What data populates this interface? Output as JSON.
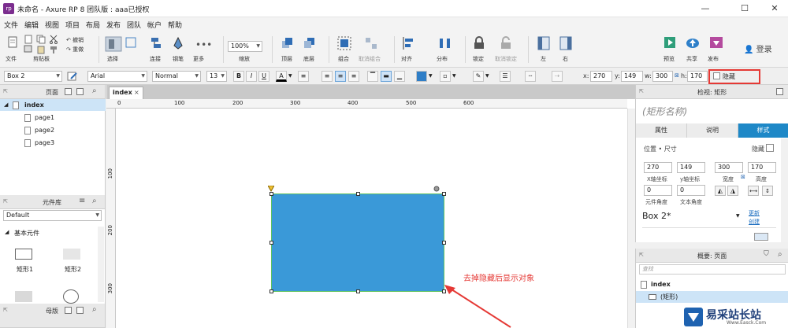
{
  "window": {
    "title": "未命名 - Axure RP 8 团队版 : aaa已授权",
    "app_icon": "rp",
    "controls": {
      "minimize": "—",
      "maximize": "☐",
      "close": "✕"
    }
  },
  "menu": [
    "文件",
    "编辑",
    "视图",
    "项目",
    "布局",
    "发布",
    "团队",
    "帐户",
    "帮助"
  ],
  "toolbar": {
    "file": "文件",
    "clipboard": "剪贴板",
    "undo": "撤销",
    "redo": "重做",
    "select": "选择",
    "connect": "连接",
    "pen": "钢笔",
    "more": "更多",
    "zoom_value": "100%",
    "zoom_label": "缩放",
    "top": "顶层",
    "bottom": "底层",
    "group": "组合",
    "ungroup": "取消组合",
    "align": "对齐",
    "distribute": "分布",
    "lock": "锁定",
    "unlock": "取消锁定",
    "left": "左",
    "right": "右",
    "preview": "预览",
    "share": "共享",
    "publish": "发布",
    "login": "登录"
  },
  "formatbar": {
    "shape_name": "Box 2",
    "font": "Arial",
    "style": "Normal",
    "size": "13",
    "bold": "B",
    "italic": "I",
    "underline": "U",
    "text_color": "A",
    "x_label": "x:",
    "x": "270",
    "y_label": "y:",
    "y": "149",
    "w_label": "w:",
    "w": "300",
    "h_label": "h:",
    "h": "170",
    "hide_label": "隐藏"
  },
  "pages_panel": {
    "title": "页面",
    "items": [
      "index",
      "page1",
      "page2",
      "page3"
    ]
  },
  "widgets_panel": {
    "title": "元件库",
    "library": "Default",
    "category": "基本元件",
    "items": [
      "矩形1",
      "矩形2"
    ]
  },
  "masters_panel": {
    "title": "母版"
  },
  "canvas": {
    "tab": "index",
    "tab_close": "×",
    "ruler_top": [
      "0",
      "100",
      "200",
      "300",
      "400",
      "500",
      "600"
    ],
    "ruler_left": [
      "100",
      "200",
      "300"
    ],
    "annotation": "去掉隐藏后显示对象"
  },
  "inspector": {
    "title": "检视: 矩形",
    "shape_name_placeholder": "(矩形名称)",
    "tabs": [
      "属性",
      "说明",
      "样式"
    ],
    "section": "位置 • 尺寸",
    "hide_label": "隐藏",
    "x": "270",
    "x_label": "X轴坐标",
    "y": "149",
    "y_label": "y轴坐标",
    "w": "300",
    "w_label": "宽度",
    "h": "170",
    "h_label": "高度",
    "rotation": "0",
    "rotation_label": "元件角度",
    "text_rotation": "0",
    "text_rotation_label": "文本角度",
    "style_name": "Box 2*",
    "style_link1": "更新",
    "style_link2": "创建"
  },
  "outline": {
    "title": "概要: 页面",
    "search_placeholder": "查找",
    "items": [
      "index",
      "(矩形)"
    ]
  },
  "watermark": {
    "text": "易采站长站",
    "sub": "Www.Easck.Com"
  },
  "colors": {
    "accent": "#1e88c7",
    "shape_fill": "#3a99d8",
    "highlight": "#e53935"
  }
}
